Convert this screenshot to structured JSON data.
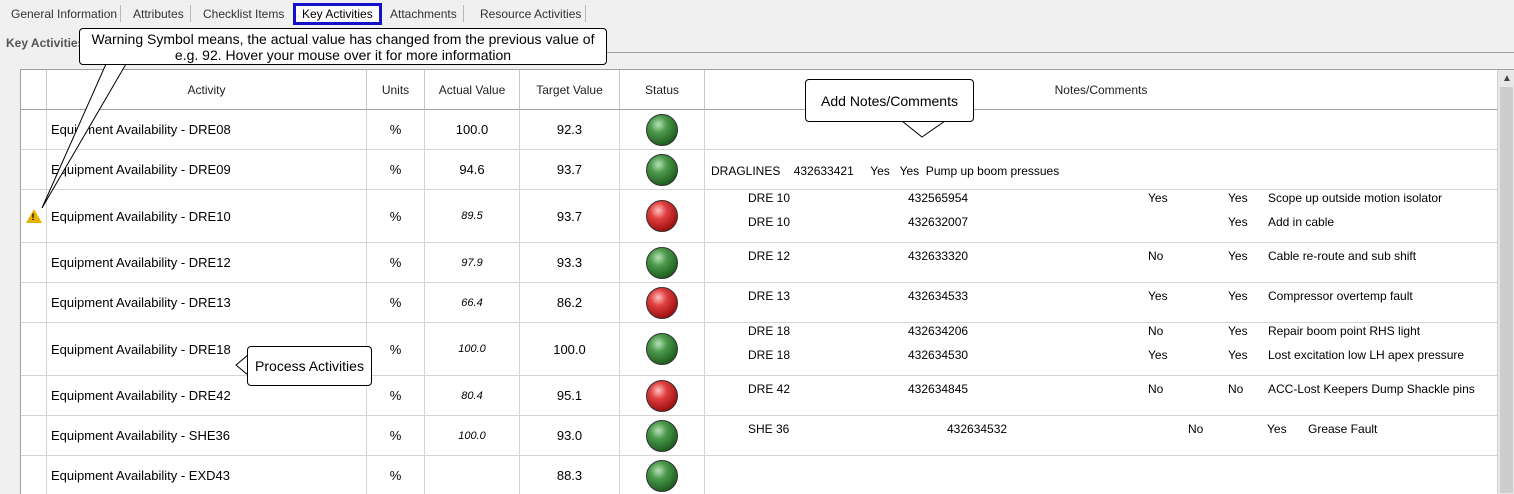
{
  "tabs": [
    {
      "label": "General Information"
    },
    {
      "label": "Attributes"
    },
    {
      "label": "Checklist Items"
    },
    {
      "label": "Key Activities",
      "active": true
    },
    {
      "label": "Attachments"
    },
    {
      "label": "Resource Activities"
    }
  ],
  "section_title": "Key Activities",
  "columns": {
    "activity": "Activity",
    "units": "Units",
    "actual": "Actual Value",
    "target": "Target Value",
    "status": "Status",
    "notes": "Notes/Comments"
  },
  "rows": [
    {
      "activity": "Equipment Availability - DRE08",
      "units": "%",
      "actual": "100.0",
      "target": "92.3",
      "status": "green",
      "notes": []
    },
    {
      "activity": "Equipment Availability - DRE09",
      "units": "%",
      "actual": "94.6",
      "target": "93.7",
      "status": "green",
      "notes": [
        {
          "text": "DRAGLINES    432633421     Yes   Yes  Pump up boom pressues"
        }
      ]
    },
    {
      "activity": "Equipment Availability - DRE10",
      "units": "%",
      "actual": "89.5",
      "target": "93.7",
      "status": "red",
      "warning": true,
      "notes": [
        {
          "c1": "DRE 10",
          "c2": "432565954",
          "c3": "Yes",
          "c4": "Yes",
          "c5": "Scope up outside motion isolator"
        },
        {
          "c1": "DRE 10",
          "c2": "432632007",
          "c3": "",
          "c4": "Yes",
          "c5": "Add in cable"
        }
      ]
    },
    {
      "activity": "Equipment Availability - DRE12",
      "units": "%",
      "actual": "97.9",
      "target": "93.3",
      "status": "green",
      "notes": [
        {
          "c1": "DRE 12",
          "c2": "432633320",
          "c3": "No",
          "c4": "Yes",
          "c5": "Cable re-route and sub shift"
        }
      ]
    },
    {
      "activity": "Equipment Availability - DRE13",
      "units": "%",
      "actual": "66.4",
      "target": "86.2",
      "status": "red",
      "notes": [
        {
          "c1": "DRE 13",
          "c2": "432634533",
          "c3": "Yes",
          "c4": "Yes",
          "c5": "Compressor overtemp fault"
        }
      ]
    },
    {
      "activity": "Equipment Availability - DRE18",
      "units": "%",
      "actual": "100.0",
      "target": "100.0",
      "status": "green",
      "notes": [
        {
          "c1": "DRE 18",
          "c2": "432634206",
          "c3": "No",
          "c4": "Yes",
          "c5": "Repair boom point RHS light"
        },
        {
          "c1": "DRE 18",
          "c2": "432634530",
          "c3": "Yes",
          "c4": "Yes",
          "c5": "Lost excitation low LH apex pressure"
        }
      ]
    },
    {
      "activity": "Equipment Availability - DRE42",
      "units": "%",
      "actual": "80.4",
      "target": "95.1",
      "status": "red",
      "notes": [
        {
          "c1": "DRE 42",
          "c2": "432634845",
          "c3": "No",
          "c4": "No",
          "c5": "ACC-Lost Keepers  Dump Shackle pins"
        }
      ]
    },
    {
      "activity": "Equipment Availability - SHE36",
      "units": "%",
      "actual": "100.0",
      "target": "93.0",
      "status": "green",
      "notes": [
        {
          "c1": "SHE 36",
          "c2": "432634532",
          "c3": "No",
          "c4": "Yes",
          "c5": "Grease Fault",
          "shifted": true
        }
      ]
    },
    {
      "activity": "Equipment Availability - EXD43",
      "units": "%",
      "actual": "",
      "target": "88.3",
      "status": "green",
      "notes": []
    }
  ],
  "callouts": {
    "warning": "Warning Symbol means, the actual value has changed from the previous value of e.g. 92. Hover your mouse over it for more information",
    "notes": "Add Notes/Comments",
    "process": "Process Activities"
  }
}
